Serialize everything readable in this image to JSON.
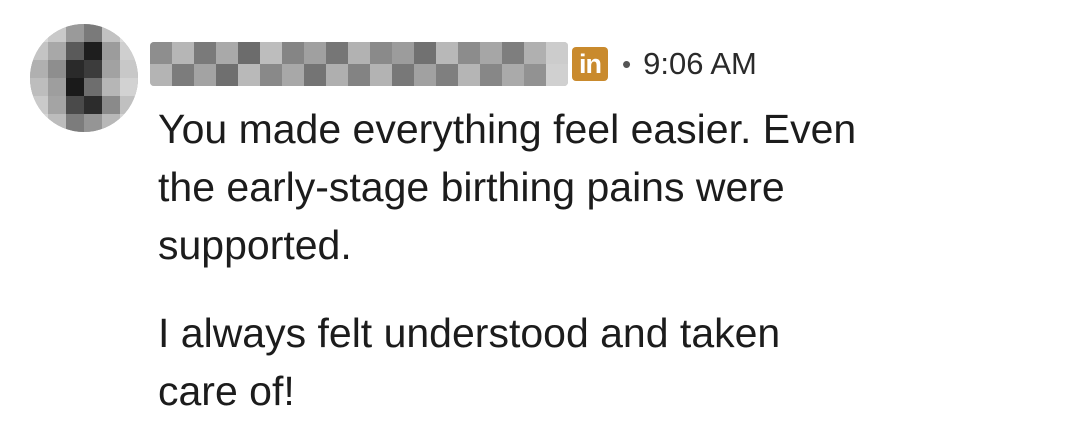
{
  "message": {
    "sender": {
      "name_obscured": true,
      "source_badge": "in",
      "badge_color": "#c98a2d",
      "badge_icon": "linkedin-icon"
    },
    "separator": "•",
    "timestamp": "9:06 AM",
    "paragraphs": [
      {
        "lines": [
          "You made everything feel easier. Even",
          "the early-stage birthing pains were",
          "supported."
        ]
      },
      {
        "lines": [
          "I always felt understood and taken",
          "care of!"
        ]
      }
    ]
  }
}
